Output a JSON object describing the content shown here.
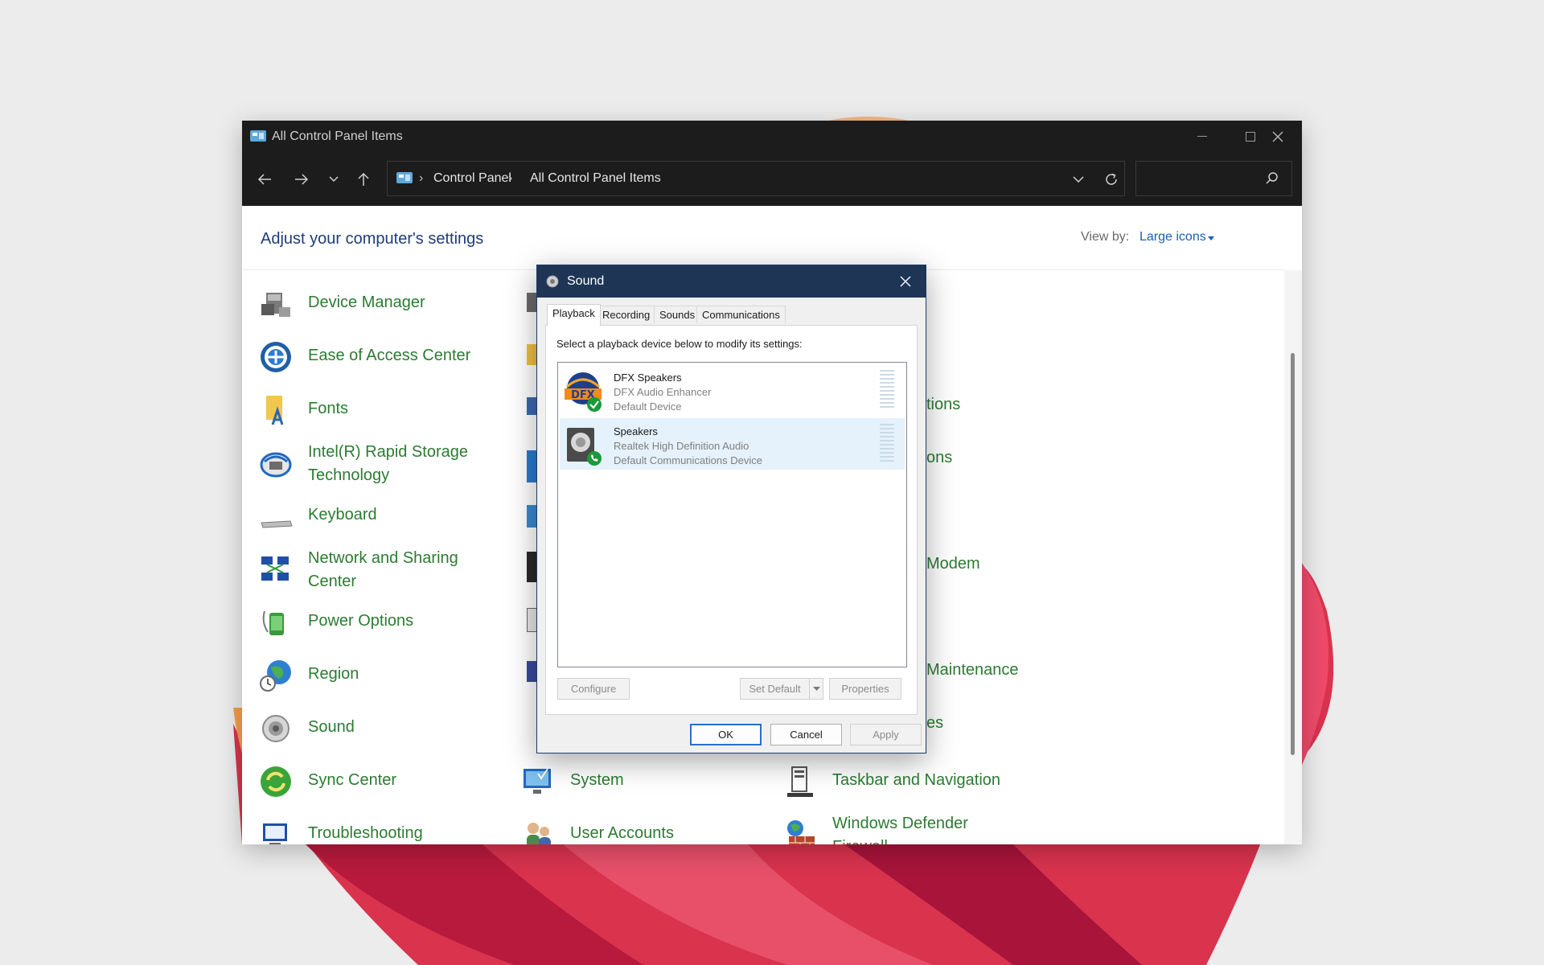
{
  "window": {
    "title": "All Control Panel Items",
    "breadcrumb": [
      "Control Panel",
      "All Control Panel Items"
    ],
    "search_placeholder": ""
  },
  "content": {
    "heading": "Adjust your computer's settings",
    "view_by_label": "View by:",
    "view_by_value": "Large icons"
  },
  "items": {
    "col1": [
      {
        "label": "Device Manager",
        "icon": "device-manager-icon"
      },
      {
        "label": "Ease of Access Center",
        "icon": "ease-of-access-icon"
      },
      {
        "label": "Fonts",
        "icon": "fonts-icon"
      },
      {
        "label": "Intel(R) Rapid Storage Technology",
        "icon": "intel-rst-icon"
      },
      {
        "label": "Keyboard",
        "icon": "keyboard-icon"
      },
      {
        "label": "Network and Sharing Center",
        "icon": "network-icon"
      },
      {
        "label": "Power Options",
        "icon": "power-options-icon"
      },
      {
        "label": "Region",
        "icon": "region-icon"
      },
      {
        "label": "Sound",
        "icon": "sound-icon"
      },
      {
        "label": "Sync Center",
        "icon": "sync-center-icon"
      },
      {
        "label": "Troubleshooting",
        "icon": "troubleshooting-icon"
      }
    ],
    "col2": [
      {
        "label": "System",
        "icon": "system-icon"
      },
      {
        "label": "User Accounts",
        "icon": "user-accounts-icon"
      }
    ],
    "col3_partial": [
      {
        "label": "tions",
        "icon": ""
      },
      {
        "label": "ons",
        "icon": ""
      },
      {
        "label": "Modem",
        "icon": ""
      },
      {
        "label": "Maintenance",
        "icon": ""
      },
      {
        "label": "es",
        "icon": ""
      }
    ],
    "col3": [
      {
        "label": "Taskbar and Navigation",
        "icon": "taskbar-icon"
      },
      {
        "label": "Windows Defender Firewall",
        "icon": "firewall-icon"
      }
    ]
  },
  "dialog": {
    "title": "Sound",
    "tabs": [
      "Playback",
      "Recording",
      "Sounds",
      "Communications"
    ],
    "active_tab": "Playback",
    "instruction": "Select a playback device below to modify its settings:",
    "devices": [
      {
        "name": "DFX Speakers",
        "driver": "DFX Audio Enhancer",
        "status": "Default Device",
        "icon": "dfx-speaker-icon",
        "selected": false
      },
      {
        "name": "Speakers",
        "driver": "Realtek High Definition Audio",
        "status": "Default Communications Device",
        "icon": "speaker-icon",
        "selected": true
      }
    ],
    "buttons": {
      "configure": "Configure",
      "set_default": "Set Default",
      "properties": "Properties",
      "ok": "OK",
      "cancel": "Cancel",
      "apply": "Apply"
    }
  },
  "colors": {
    "item_text": "#2c7b32",
    "heading": "#1e3d7a",
    "titlebar": "#1c1c1c",
    "dialog_titlebar": "#1e3556",
    "selection": "#e5f1fb"
  }
}
